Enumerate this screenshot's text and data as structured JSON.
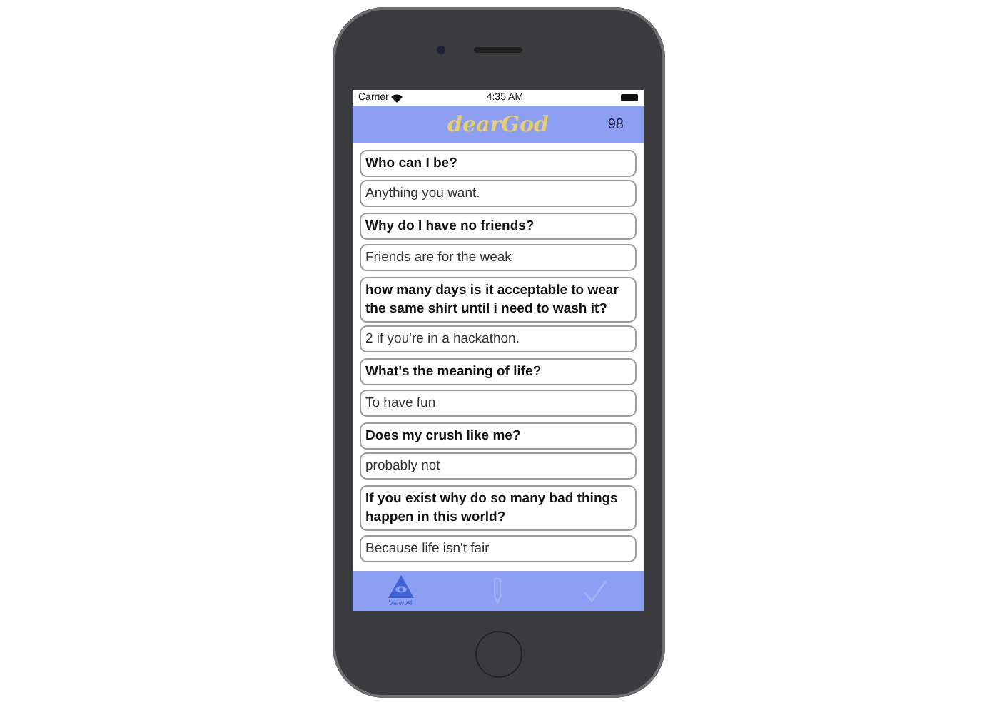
{
  "status_bar": {
    "carrier": "Carrier",
    "time": "4:35 AM"
  },
  "nav_bar": {
    "logo": "dearGod",
    "count": "98"
  },
  "entries": [
    {
      "question": "Who can I be?",
      "answer": "Anything you want."
    },
    {
      "question": "Why do I have no friends?",
      "answer": "Friends are for the weak"
    },
    {
      "question": "how many days is it acceptable to wear the same shirt until i need to wash it?",
      "answer": "2 if you're in a hackathon."
    },
    {
      "question": "What's the meaning of life?",
      "answer": "To have fun"
    },
    {
      "question": "Does my crush like me?",
      "answer": "probably not"
    },
    {
      "question": "If you exist why do so many bad things happen in this world?",
      "answer": "Because life isn't fair"
    }
  ],
  "tab_bar": [
    {
      "kind": "eye-triangle",
      "label": "View All",
      "selected": true
    },
    {
      "kind": "pencil",
      "selected": false
    },
    {
      "kind": "check",
      "selected": false
    }
  ]
}
